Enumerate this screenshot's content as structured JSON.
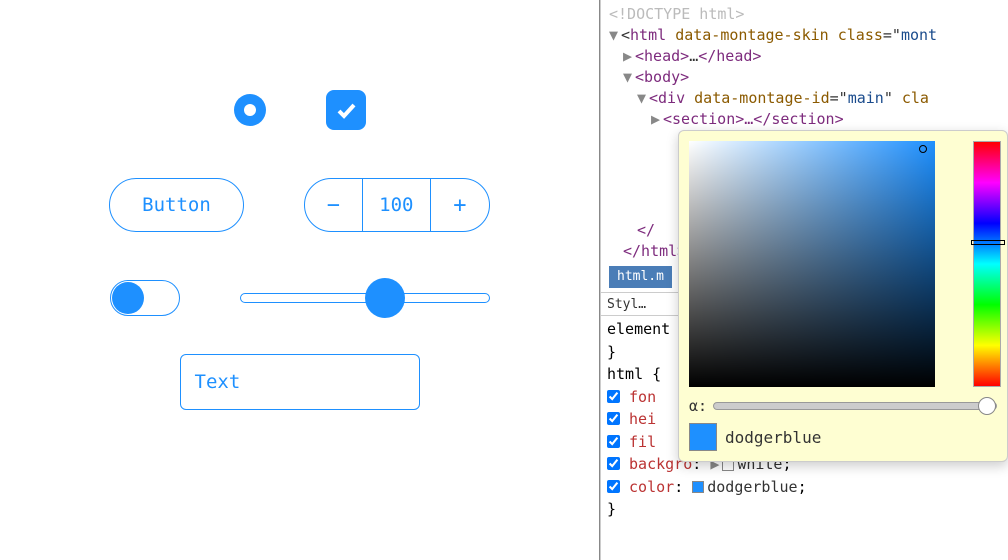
{
  "ui": {
    "button_label": "Button",
    "stepper_value": "100",
    "text_input_value": "Text"
  },
  "dom": {
    "line0": "<!DOCTYPE html>",
    "html_tag": "html",
    "html_attr1": "data-montage-skin",
    "html_classattr": "class",
    "html_classval": "mont",
    "head_open": "<head>",
    "head_ellipsis": "…",
    "head_close": "</head>",
    "body_open": "<body>",
    "div_open": "<div",
    "div_attr": "data-montage-id",
    "div_val": "main",
    "div_cla": "cla",
    "section": "<section>…</section>",
    "close_gen": "</",
    "close_html": "</html>",
    "crumb": "html.m"
  },
  "styles_tab": "Styl…",
  "css": {
    "sel1": "element",
    "sel2": "html",
    "prop_font": "fon",
    "prop_hei": "hei",
    "prop_fil": "fil",
    "prop_bg": "backgro",
    "prop_bg_val": "white",
    "prop_color": "color",
    "val_color": "dodgerblue"
  },
  "picker": {
    "alpha_label": "α:",
    "color_name": "dodgerblue",
    "color_hex": "#1e90ff"
  }
}
